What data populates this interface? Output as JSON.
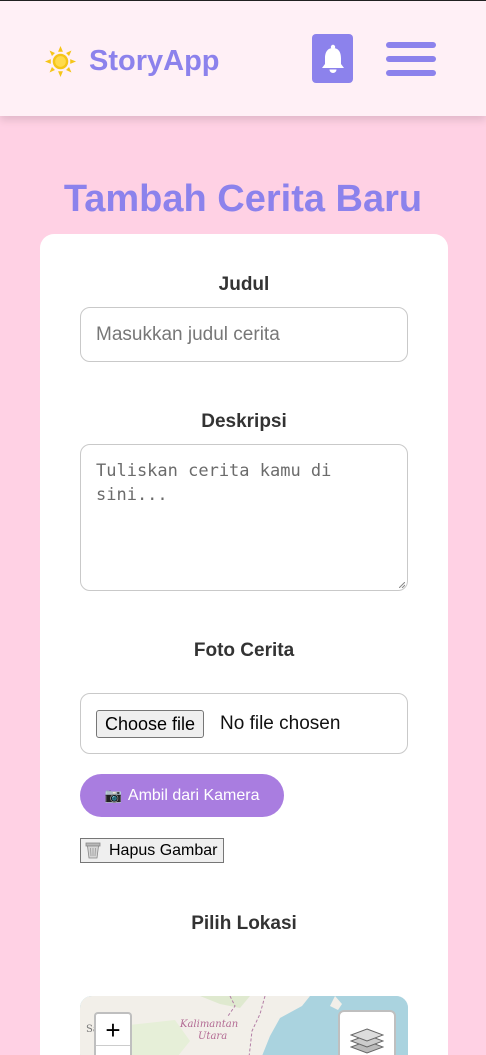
{
  "app": {
    "name": "StoryApp"
  },
  "header": {
    "logo_icon": "sun-icon",
    "bell_icon": "bell-icon",
    "menu_icon": "hamburger-menu-icon"
  },
  "page": {
    "title": "Tambah Cerita Baru"
  },
  "form": {
    "title_label": "Judul",
    "title_placeholder": "Masukkan judul cerita",
    "description_label": "Deskripsi",
    "description_placeholder": "Tuliskan cerita kamu di sini...",
    "photo_label": "Foto Cerita",
    "choose_file_label": "Choose file",
    "no_file_text": "No file chosen",
    "camera_button_icon": "📷",
    "camera_button_label": "Ambil dari Kamera",
    "delete_button_label": "Hapus Gambar",
    "location_label": "Pilih Lokasi"
  },
  "map": {
    "zoom_in_label": "+",
    "place_label": "Kalimantan Utara",
    "place_label_line1": "Kalimantan",
    "place_label_line2": "Utara",
    "edge_label": "Sa"
  },
  "colors": {
    "background": "#ffd1e4",
    "header": "#fff0f6",
    "brand": "#8c82ec",
    "camera_button": "#a97de0",
    "card": "#ffffff"
  }
}
